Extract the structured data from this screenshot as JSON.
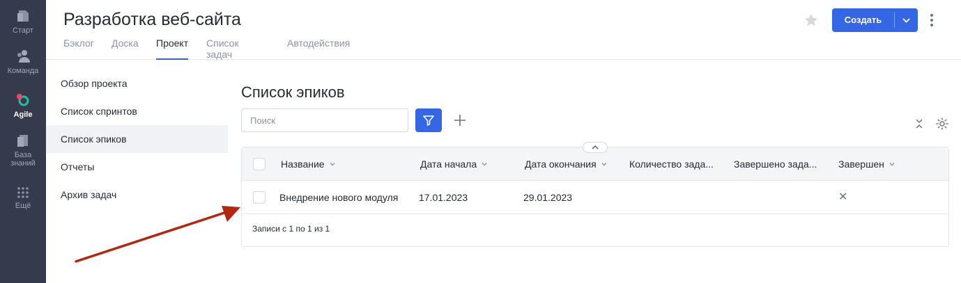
{
  "rail": {
    "items": [
      {
        "label": "Старт",
        "icon": "home-icon"
      },
      {
        "label": "Команда",
        "icon": "team-icon"
      },
      {
        "label": "Agile",
        "icon": "agile-icon"
      },
      {
        "label": "База знаний",
        "icon": "knowledge-base-icon"
      },
      {
        "label": "Ещё",
        "icon": "grid-icon"
      }
    ]
  },
  "header": {
    "title": "Разработка веб-сайта",
    "tabs": [
      "Бэклог",
      "Доска",
      "Проект",
      "Список задач",
      "Автодействия"
    ],
    "active_tab": "Проект",
    "create_label": "Создать"
  },
  "sidenav": {
    "items": [
      "Обзор проекта",
      "Список спринтов",
      "Список эпиков",
      "Отчеты",
      "Архив задач"
    ],
    "active": "Список эпиков"
  },
  "main": {
    "title": "Список эпиков",
    "search_placeholder": "Поиск"
  },
  "table": {
    "columns": [
      "Название",
      "Дата начала",
      "Дата окончания",
      "Количество зада...",
      "Завершено зада...",
      "Завершен"
    ],
    "rows": [
      {
        "name": "Внедрение нового модуля",
        "start": "17.01.2023",
        "end": "29.01.2023",
        "count": "",
        "done": "",
        "completed": "✕"
      }
    ],
    "footer": "Записи с 1 по 1 из 1"
  },
  "colors": {
    "accent": "#3566e5",
    "rail_bg": "#363a4d",
    "agile_icon": "#20c19a",
    "arrow": "#b3260f"
  }
}
